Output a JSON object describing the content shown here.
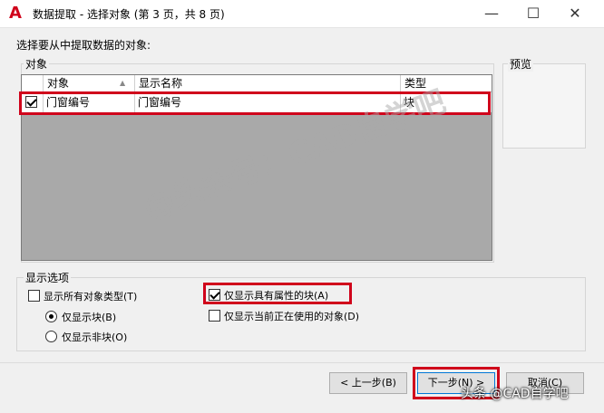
{
  "window": {
    "title": "数据提取 - 选择对象 (第 3 页，共 8 页)",
    "app_icon_glyph": "A",
    "min_glyph": "—",
    "max_glyph": "☐",
    "close_glyph": "✕"
  },
  "prompt": "选择要从中提取数据的对象:",
  "objects_group": {
    "label": "对象",
    "columns": [
      "对象",
      "显示名称",
      "类型"
    ],
    "sort_glyph": "▲",
    "rows": [
      {
        "checked": true,
        "object": "门窗编号",
        "display_name": "门窗编号",
        "type": "块"
      }
    ]
  },
  "preview_group": {
    "label": "预览"
  },
  "display_options": {
    "label": "显示选项",
    "show_all_types": {
      "label": "显示所有对象类型(T)",
      "checked": false
    },
    "show_blocks_only": {
      "label": "仅显示块(B)",
      "selected": true
    },
    "show_nonblocks_only": {
      "label": "仅显示非块(O)",
      "selected": false
    },
    "show_blocks_with_attributes": {
      "label": "仅显示具有属性的块(A)",
      "checked": true
    },
    "show_objects_in_use": {
      "label": "仅显示当前正在使用的对象(D)",
      "checked": false
    }
  },
  "buttons": {
    "back": "< 上一步(B)",
    "next": "下一步(N) >",
    "cancel": "取消(C)"
  },
  "watermark": "@头条号：CAD自学吧",
  "corner_mark": "头条 @CAD自学吧",
  "colors": {
    "highlight": "#d0021b",
    "grid_bg": "#a9a9a9"
  }
}
